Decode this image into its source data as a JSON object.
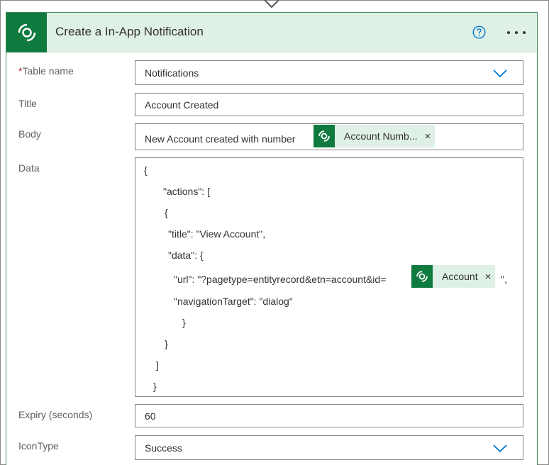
{
  "header": {
    "title": "Create a In-App Notification",
    "icon": "dataverse-logo-icon",
    "accent": "#0e7a3e"
  },
  "fields": {
    "table_name": {
      "required": "*",
      "label": "Table name",
      "value": "Notifications"
    },
    "title": {
      "label": "Title",
      "value": "Account Created"
    },
    "body": {
      "label": "Body",
      "prefix": "New Account created with number",
      "token": "Account Numb...",
      "token_close": "×"
    },
    "data": {
      "label": "Data",
      "lines": {
        "l1": "{",
        "l2": "\"actions\": [",
        "l3": "{",
        "l4": "\"title\": \"View Account\",",
        "l5": "\"data\": {",
        "l6_prefix": "\"url\": \"?pagetype=entityrecord&etn=account&id=",
        "l6_suffix": "\",",
        "l7": "\"navigationTarget\": \"dialog\"",
        "l8": "}",
        "l9": "}",
        "l10": "]",
        "l11": "}"
      },
      "token": "Account",
      "token_close": "×"
    },
    "expiry": {
      "label": "Expiry (seconds)",
      "value": "60"
    },
    "icon_type": {
      "label": "IconType",
      "value": "Success"
    }
  }
}
